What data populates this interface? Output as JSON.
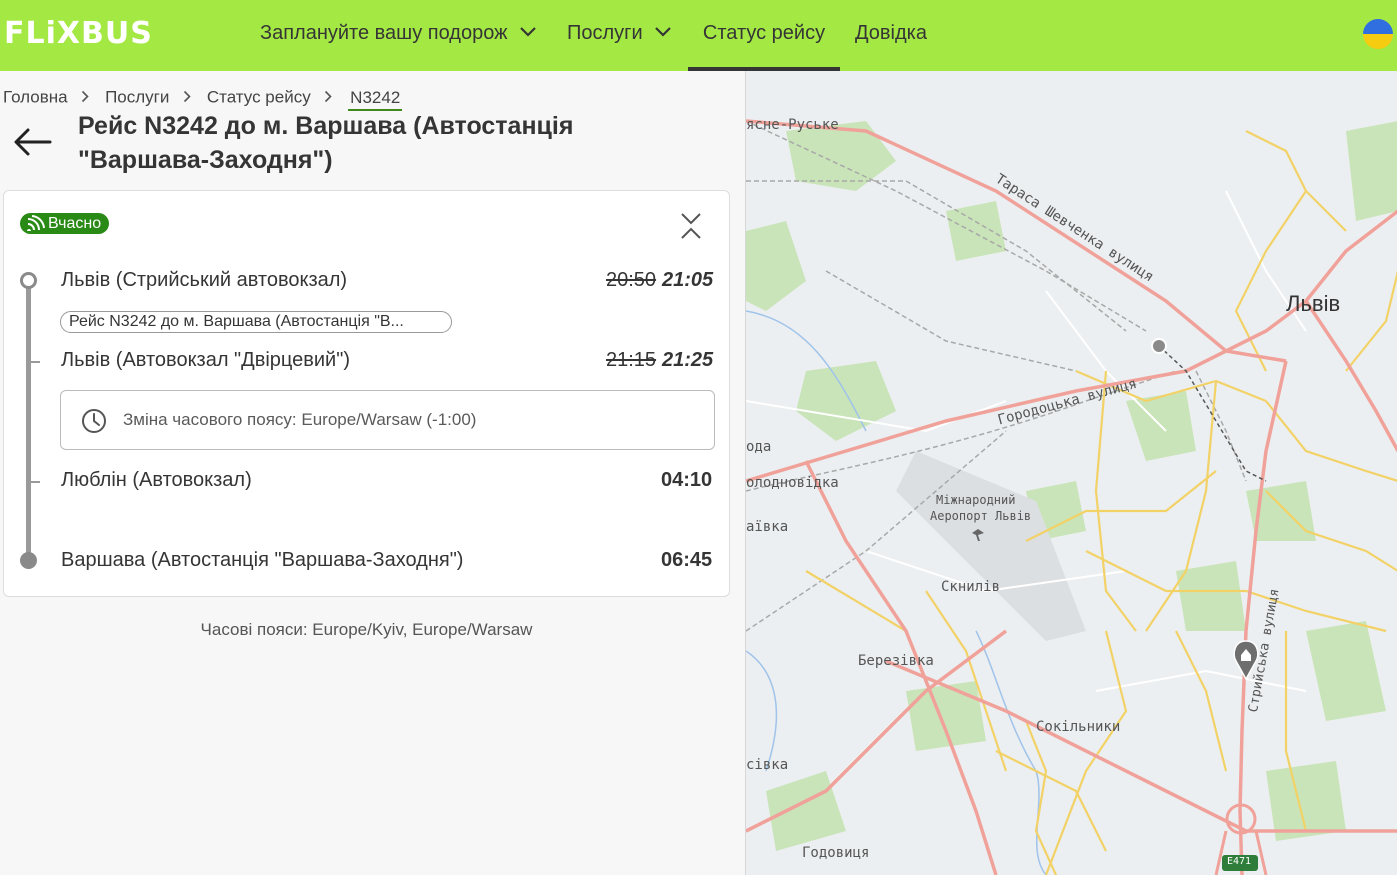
{
  "header": {
    "logo": "FLiXBUS",
    "nav": [
      {
        "label": "Заплануйте вашу подорож"
      },
      {
        "label": "Послуги"
      },
      {
        "label": "Статус рейсу"
      },
      {
        "label": "Довідка"
      }
    ]
  },
  "breadcrumb": {
    "home": "Головна",
    "services": "Послуги",
    "status": "Статус рейсу",
    "current": "N3242"
  },
  "title": "Рейс N3242 до м. Варшава (Автостанція \"Варшава-Заходня\")",
  "status_badge": "Вчасно",
  "stops": [
    {
      "name": "Львів (Стрийський автовокзал)",
      "scheduled": "20:50",
      "actual": "21:05"
    },
    {
      "name": "Львів (Автовокзал \"Двірцевий\")",
      "scheduled": "21:15",
      "actual": "21:25"
    },
    {
      "name": "Люблін (Автовокзал)",
      "time": "04:10"
    },
    {
      "name": "Варшава (Автостанція \"Варшава-Заходня\")",
      "time": "06:45"
    }
  ],
  "trip_pill": "Рейс N3242 до м. Варшава (Автостанція \"В...",
  "timezone_change": "Зміна часового поясу: Europe/Warsaw (-1:00)",
  "timezones_note": "Часові пояси: Europe/Kyiv, Europe/Warsaw",
  "map": {
    "labels": {
      "lviv": "Львів",
      "shevchenka": "Тараса Шевченка вулиця",
      "horodotska": "Городоцька вулиця",
      "airport_1": "Міжнародний",
      "airport_2": "Аеропорт Львів",
      "sknyliv": "Скнилів",
      "berezivka": "Березівка",
      "sokilnyky": "Сокільники",
      "holodnovidka": "олодновідка",
      "yasne_ruske": "ясне-Руське",
      "oda": "ода",
      "aivka": "аївка",
      "sivka": "сівка",
      "hodovytsia": "Годовиця",
      "e471": "E471",
      "stryiska": "Стрийська вулиця"
    }
  }
}
